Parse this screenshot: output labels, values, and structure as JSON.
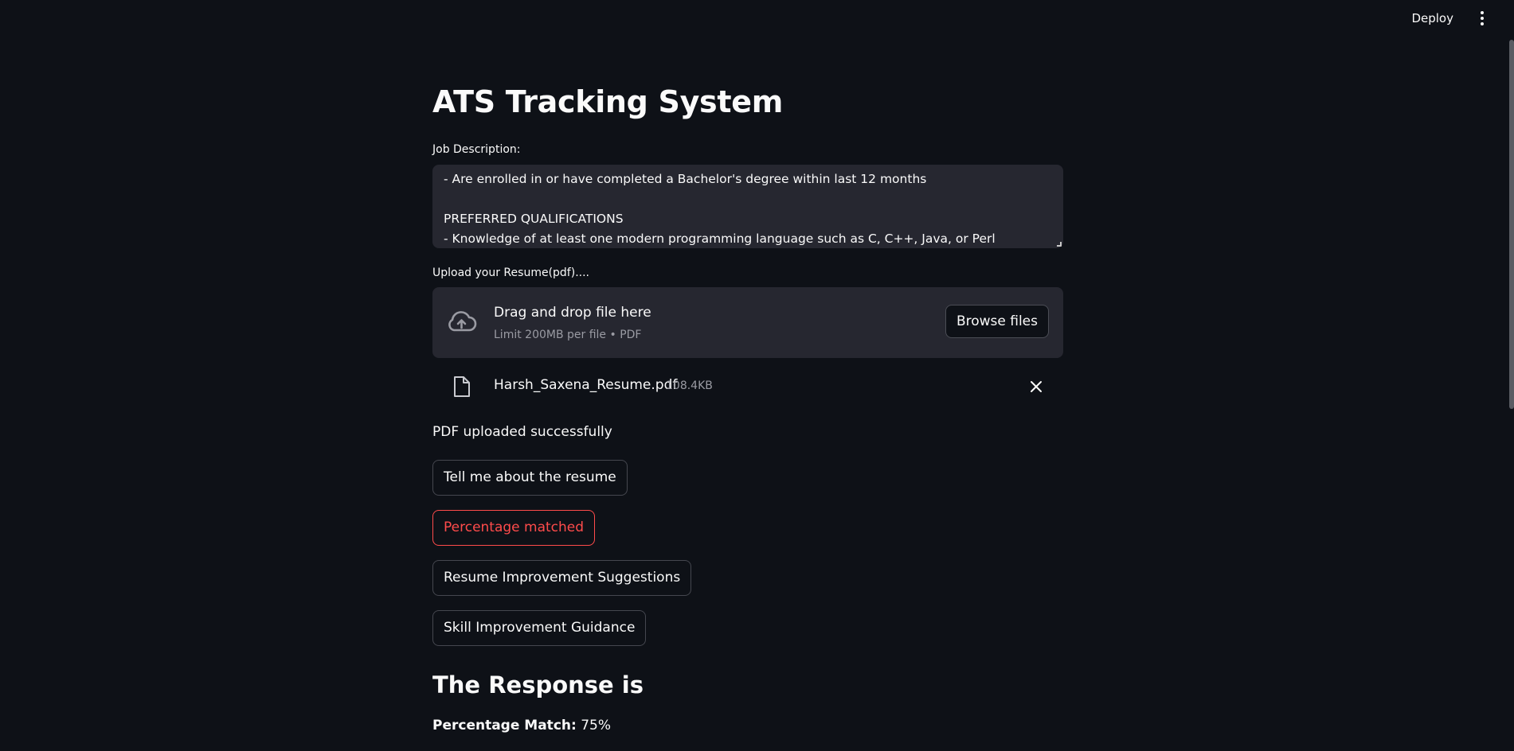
{
  "header": {
    "deploy_label": "Deploy",
    "menu_icon": "more-vertical-icon"
  },
  "title": "ATS Tracking System",
  "job_description": {
    "label": "Job Description:",
    "lines": [
      "- Are enrolled in or have completed a Bachelor's degree within last 12 months",
      "",
      "PREFERRED QUALIFICATIONS",
      "- Knowledge of at least one modern programming language such as C, C++, Java, or Perl"
    ]
  },
  "upload": {
    "label": "Upload your Resume(pdf)....",
    "dropzone_title": "Drag and drop file here",
    "dropzone_subtitle": "Limit 200MB per file • PDF",
    "browse_label": "Browse files",
    "icon": "cloud-upload-icon"
  },
  "file": {
    "name": "Harsh_Saxena_Resume.pdf",
    "size": "108.4KB",
    "icon": "file-icon"
  },
  "status": "PDF uploaded successfully",
  "buttons": {
    "about": "Tell me about the resume",
    "percentage": "Percentage matched",
    "resume_suggestions": "Resume Improvement Suggestions",
    "skill_guidance": "Skill Improvement Guidance"
  },
  "response": {
    "heading": "The Response is",
    "match_label": "Percentage Match:",
    "match_value": " 75%"
  },
  "colors": {
    "background": "#0e1117",
    "surface": "#262730",
    "accent": "#ff4b4b",
    "text": "#fafafa",
    "muted": "#9a9ba3"
  }
}
